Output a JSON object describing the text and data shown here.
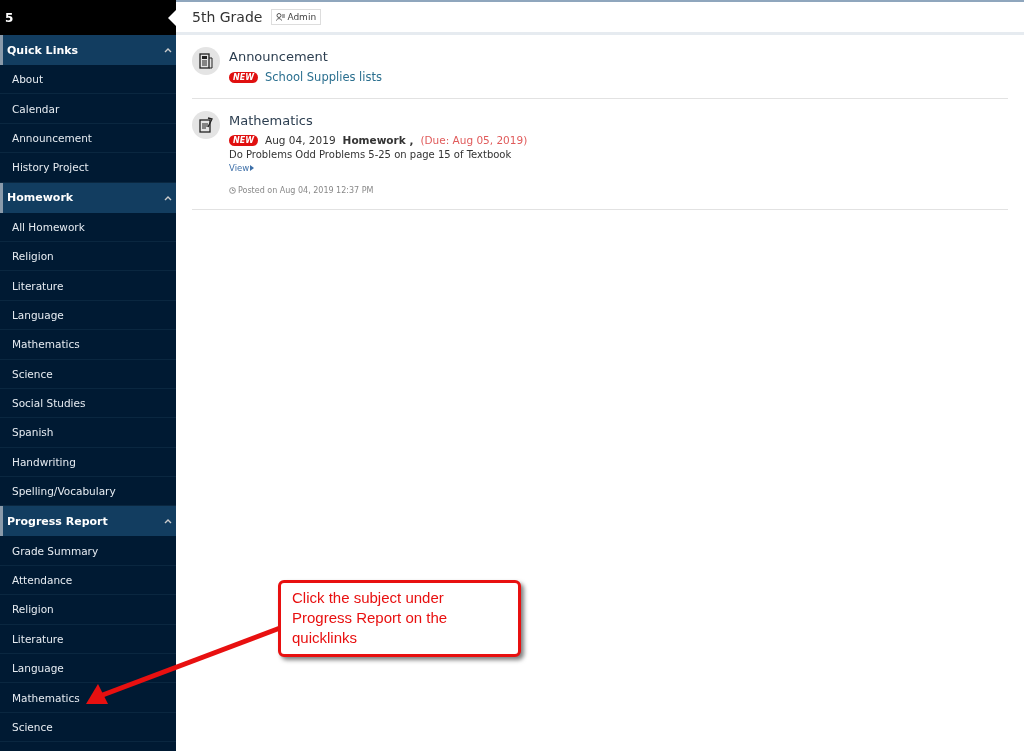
{
  "sidebar": {
    "title": "5",
    "sections": [
      {
        "title": "Quick Links",
        "expanded": true,
        "items": [
          "About",
          "Calendar",
          "Announcement",
          "History Project"
        ]
      },
      {
        "title": "Homework",
        "expanded": true,
        "items": [
          "All Homework",
          "Religion",
          "Literature",
          "Language",
          "Mathematics",
          "Science",
          "Social Studies",
          "Spanish",
          "Handwriting",
          "Spelling/Vocabulary"
        ]
      },
      {
        "title": "Progress Report",
        "expanded": true,
        "items": [
          "Grade Summary",
          "Attendance",
          "Religion",
          "Literature",
          "Language",
          "Mathematics",
          "Science"
        ]
      }
    ]
  },
  "header": {
    "title": "5th Grade",
    "role": "Admin"
  },
  "posts": [
    {
      "kind": "announcement",
      "title": "Announcement",
      "badge": "NEW",
      "link": "School Supplies lists"
    },
    {
      "kind": "homework",
      "title": "Mathematics",
      "badge": "NEW",
      "date": "Aug 04, 2019",
      "type": "Homework ,",
      "due": "(Due: Aug 05, 2019)",
      "body": "Do Problems Odd Problems 5-25 on page 15 of Textbook",
      "view": "View",
      "posted": "Posted on Aug 04, 2019 12:37 PM"
    }
  ],
  "callout": {
    "text": "Click the subject under Progress Report on the quicklinks"
  }
}
